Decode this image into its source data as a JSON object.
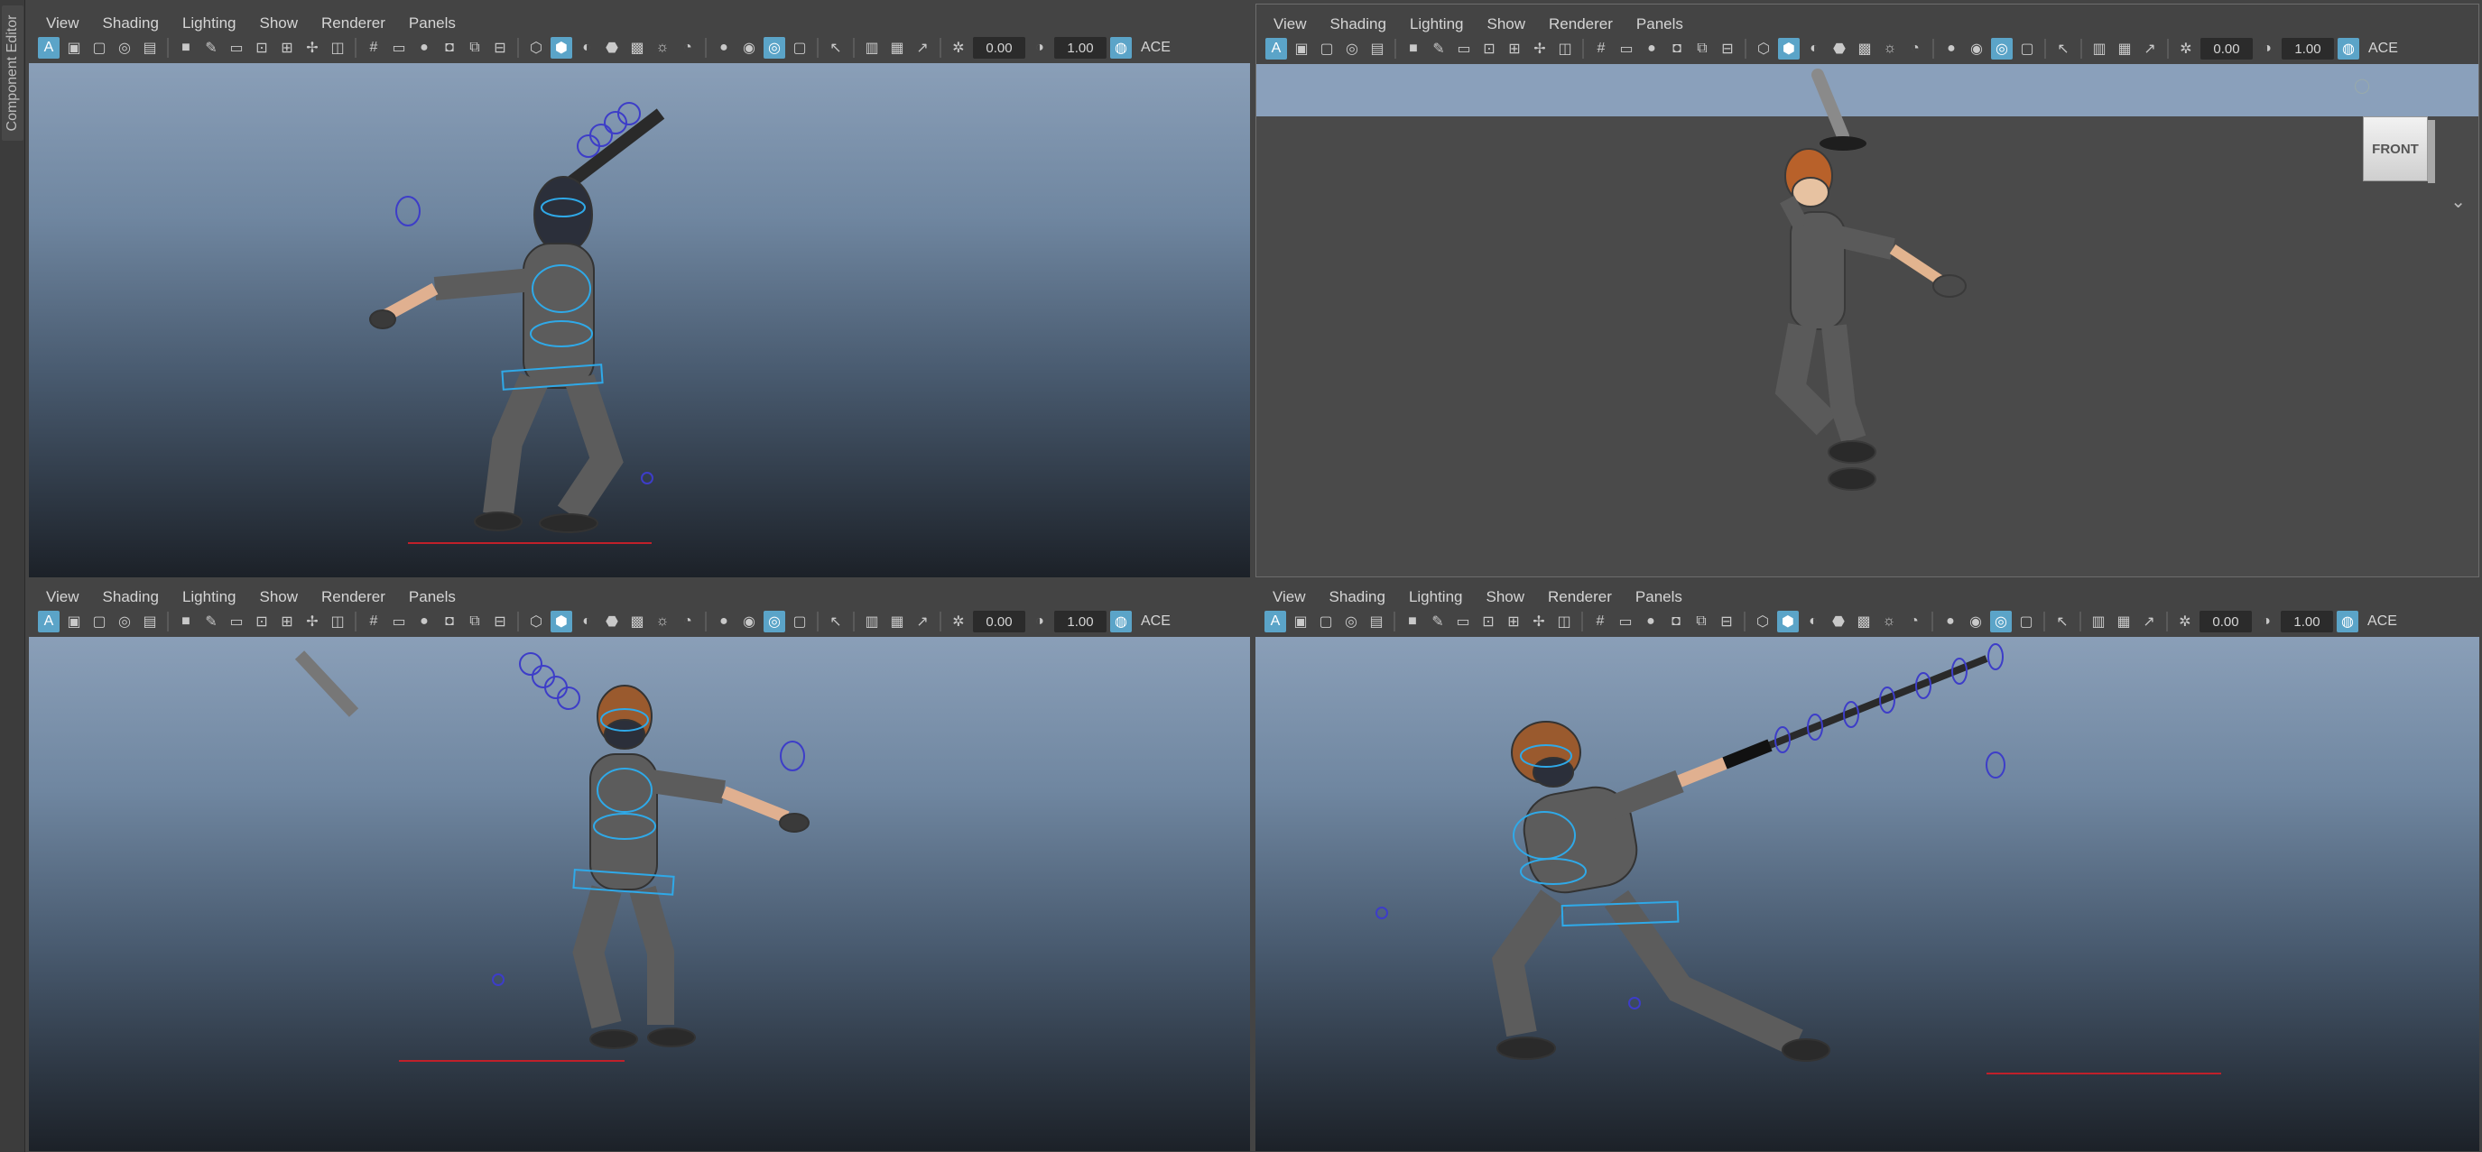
{
  "app": {
    "side_tab": "Component Editor"
  },
  "menus": [
    "View",
    "Shading",
    "Lighting",
    "Show",
    "Renderer",
    "Panels"
  ],
  "toolbar": {
    "exposure": "0.00",
    "gamma": "1.00",
    "color_mgmt_label": "ACE"
  },
  "viewcube": {
    "label": "FRONT"
  }
}
